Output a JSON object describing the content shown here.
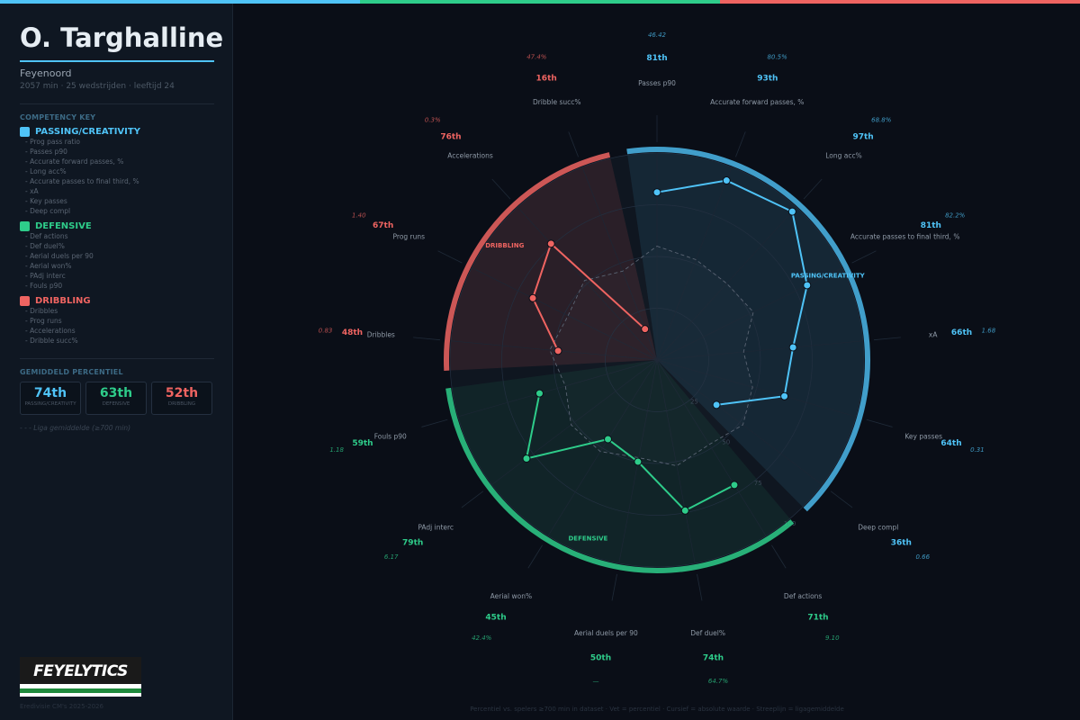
{
  "colors": {
    "passing": "#4fc3f7",
    "defensive": "#2ecc8a",
    "dribbling": "#ef6461",
    "bg": "#0a0e17"
  },
  "sidebar": {
    "player_name": "O. Targhalline",
    "club": "Feyenoord",
    "meta": "2057 min  ·  25 wedstrijden  ·  leeftijd 24",
    "competency_key_title": "COMPETENCY KEY",
    "groups": [
      {
        "name": "PASSING/CREATIVITY",
        "items": [
          "- Prog pass ratio",
          "- Passes p90",
          "- Accurate forward passes, %",
          "- Long acc%",
          "- Accurate passes to final third, %",
          "- xA",
          "- Key passes",
          "- Deep compl"
        ]
      },
      {
        "name": "DEFENSIVE",
        "items": [
          "- Def actions",
          "- Def duel%",
          "- Aerial duels per 90",
          "- Aerial won%",
          "- PAdj interc",
          "- Fouls p90"
        ]
      },
      {
        "name": "DRIBBLING",
        "items": [
          "- Dribbles",
          "- Prog runs",
          "- Accelerations",
          "- Dribble succ%"
        ]
      }
    ],
    "avg_title": "GEMIDDELD PERCENTIEL",
    "averages": [
      {
        "value": "74th",
        "label": "PASSING/CREATIVITY"
      },
      {
        "value": "63th",
        "label": "DEFENSIVE"
      },
      {
        "value": "52th",
        "label": "DRIBBLING"
      }
    ],
    "legend_note": "- - -  Liga gemiddelde (≥700 min)",
    "logo_text": "FEYELYTICS",
    "copyright": "Eredivisie CM's 2025-2026"
  },
  "footer": "Percentiel vs. spelers ≥700 min in dataset  ·  Vet = percentiel  ·  Cursief = absolute waarde  ·  Streeplijn = ligagemiddelde",
  "chart_data": {
    "type": "radar",
    "scale_ticks": [
      "25",
      "50",
      "75",
      "100"
    ],
    "group_labels": [
      "PASSING/CREATIVITY",
      "DEFENSIVE",
      "DRIBBLING"
    ],
    "metrics": [
      {
        "name": "Passes p90",
        "group": 0,
        "percentile": "81th",
        "pct": 81,
        "value": "46.42",
        "avg": 55
      },
      {
        "name": "Accurate forward passes, %",
        "group": 0,
        "percentile": "93th",
        "pct": 93,
        "value": "80.5%",
        "avg": 52
      },
      {
        "name": "Long acc%",
        "group": 0,
        "percentile": "97th",
        "pct": 97,
        "value": "68.8%",
        "avg": 50
      },
      {
        "name": "Accurate passes to final third, %",
        "group": 0,
        "percentile": "81th",
        "pct": 81,
        "value": "82.2%",
        "avg": 52
      },
      {
        "name": "xA",
        "group": 0,
        "percentile": "66th",
        "pct": 66,
        "value": "1.68",
        "avg": 42
      },
      {
        "name": "Key passes",
        "group": 0,
        "percentile": "64th",
        "pct": 64,
        "value": "0.31",
        "avg": 48
      },
      {
        "name": "Deep compl",
        "group": 0,
        "percentile": "36th",
        "pct": 36,
        "value": "0.66",
        "avg": 52
      },
      {
        "name": "Def actions",
        "group": 1,
        "percentile": "71th",
        "pct": 71,
        "value": "9.10",
        "avg": 48
      },
      {
        "name": "Def duel%",
        "group": 1,
        "percentile": "74th",
        "pct": 74,
        "value": "64.7%",
        "avg": 52
      },
      {
        "name": "Aerial duels per 90",
        "group": 1,
        "percentile": "50th",
        "pct": 50,
        "value": "—",
        "avg": 48
      },
      {
        "name": "Aerial won%",
        "group": 1,
        "percentile": "45th",
        "pct": 45,
        "value": "42.4%",
        "avg": 52
      },
      {
        "name": "PAdj interc",
        "group": 1,
        "percentile": "79th",
        "pct": 79,
        "value": "6.17",
        "avg": 52
      },
      {
        "name": "Fouls p90",
        "group": 1,
        "percentile": "59th",
        "pct": 59,
        "value": "1.18",
        "avg": 46
      },
      {
        "name": "Dribbles",
        "group": 2,
        "percentile": "48th",
        "pct": 48,
        "value": "0.83",
        "avg": 52
      },
      {
        "name": "Prog runs",
        "group": 2,
        "percentile": "67th",
        "pct": 67,
        "value": "1.40",
        "avg": 48
      },
      {
        "name": "Accelerations",
        "group": 2,
        "percentile": "76th",
        "pct": 76,
        "value": "0.3%",
        "avg": 52
      },
      {
        "name": "Dribble succ%",
        "group": 2,
        "percentile": "16th",
        "pct": 16,
        "value": "47.4%",
        "avg": 46
      }
    ]
  }
}
